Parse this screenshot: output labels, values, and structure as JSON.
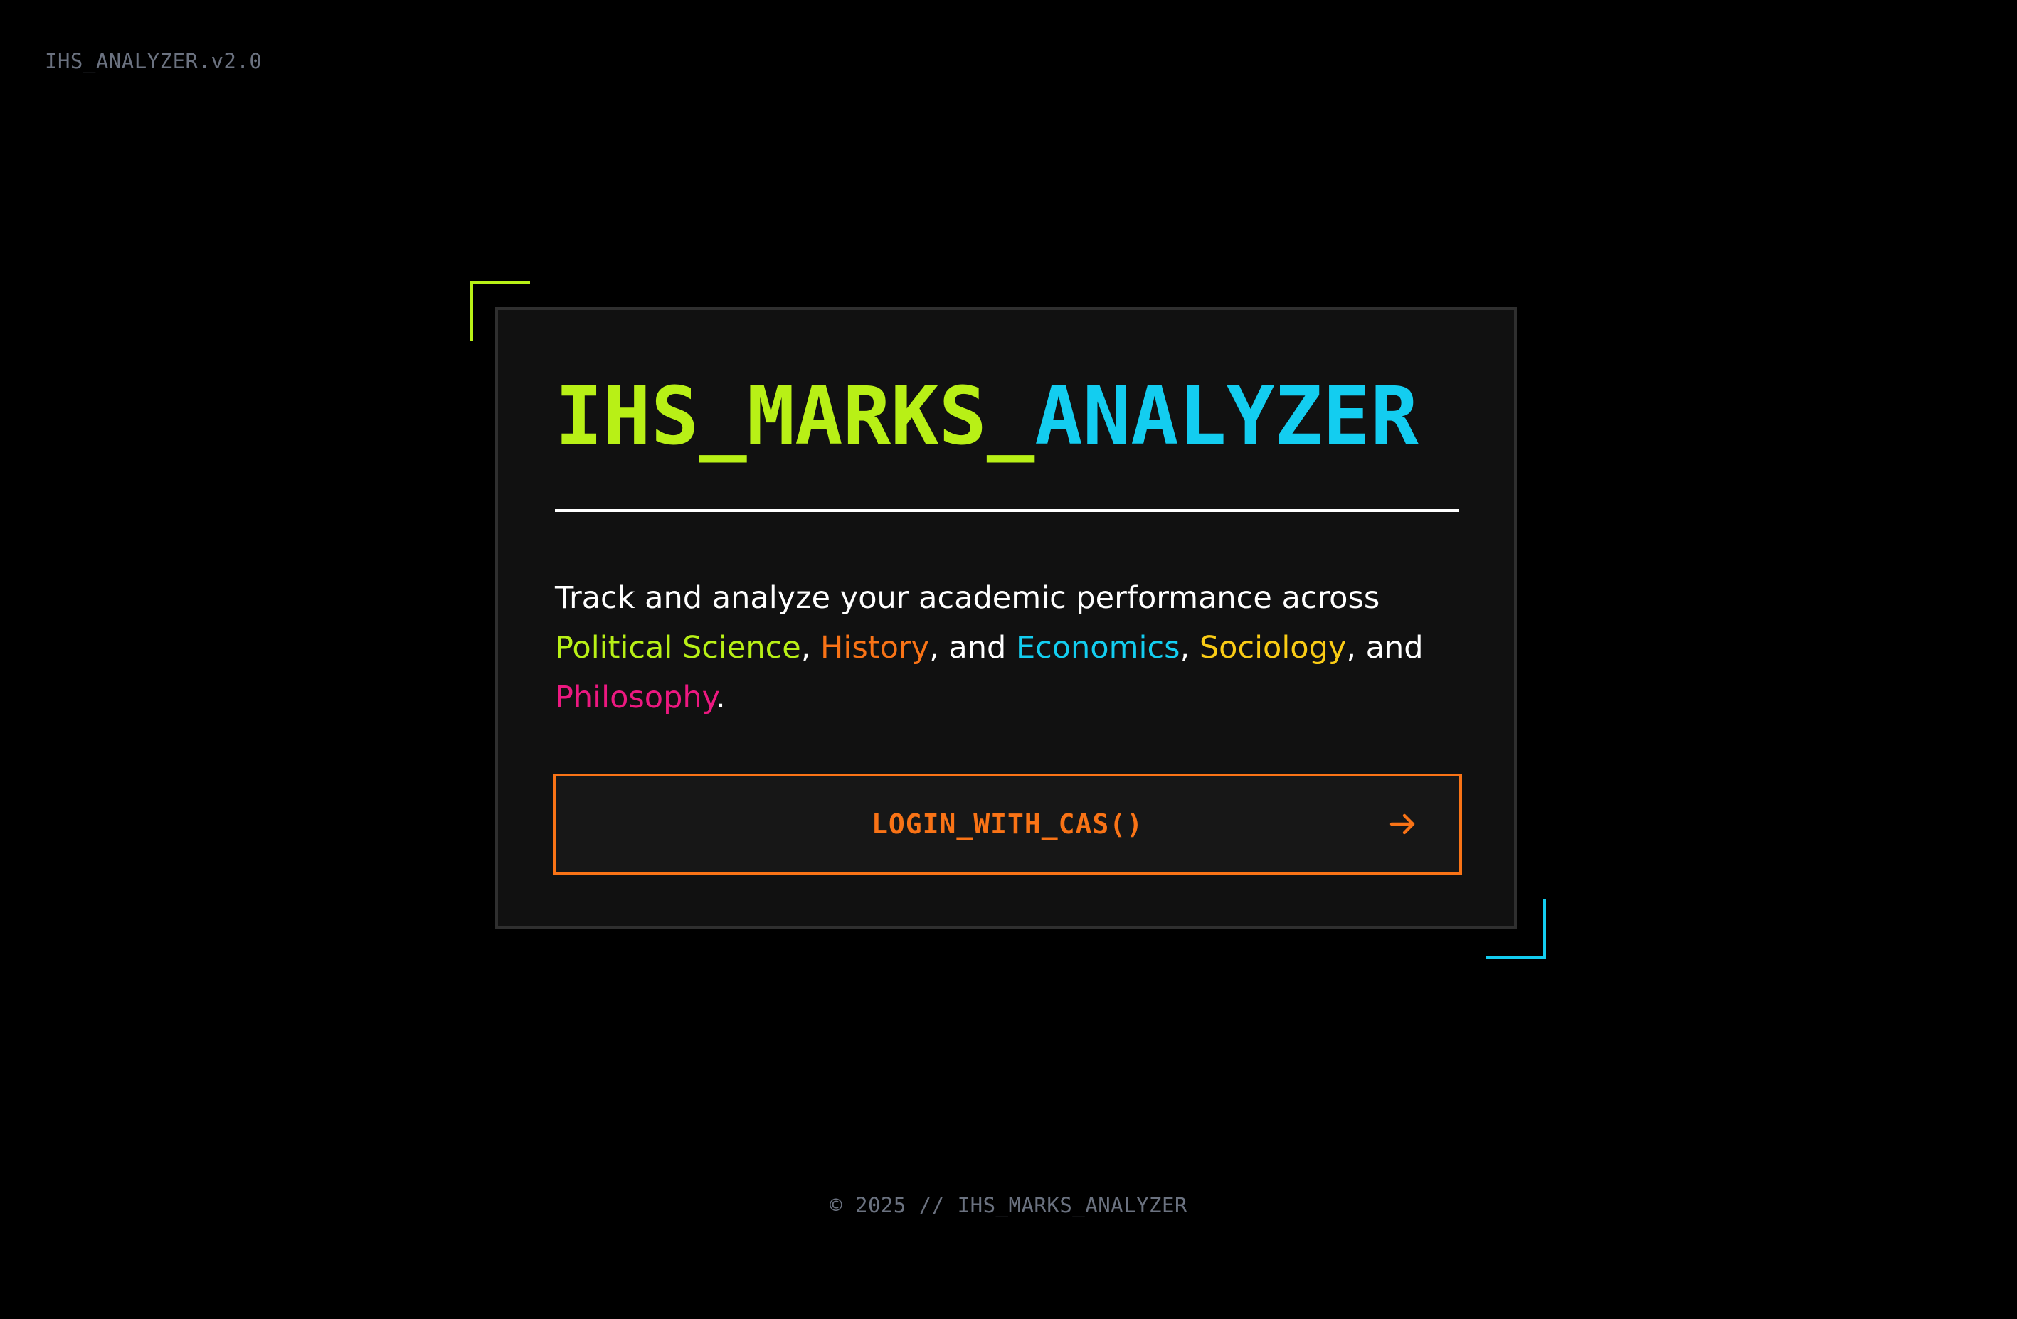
{
  "app": {
    "version_tag": "IHS_ANALYZER.v2.0"
  },
  "card": {
    "title_part1": "IHS_MARKS_",
    "title_part2": "ANALYZER",
    "description": {
      "intro": "Track and analyze your academic performance across ",
      "subject1": "Political Science",
      "sep1": ", ",
      "subject2": "History",
      "sep2": ", and ",
      "subject3": "Economics",
      "sep3": ", ",
      "subject4": "Sociology",
      "sep4": ", and ",
      "subject5": "Philosophy",
      "end": "."
    },
    "login_button": {
      "label": "LOGIN_WITH_CAS()",
      "icon": "arrow-right-icon"
    }
  },
  "footer": {
    "text": "© 2025 // IHS_MARKS_ANALYZER"
  },
  "colors": {
    "background": "#000000",
    "card_bg": "#111111",
    "lime": "#b8f016",
    "cyan": "#13cdf0",
    "orange": "#f97316",
    "yellow": "#facc15",
    "pink": "#ec1880",
    "muted": "#6b7280"
  }
}
